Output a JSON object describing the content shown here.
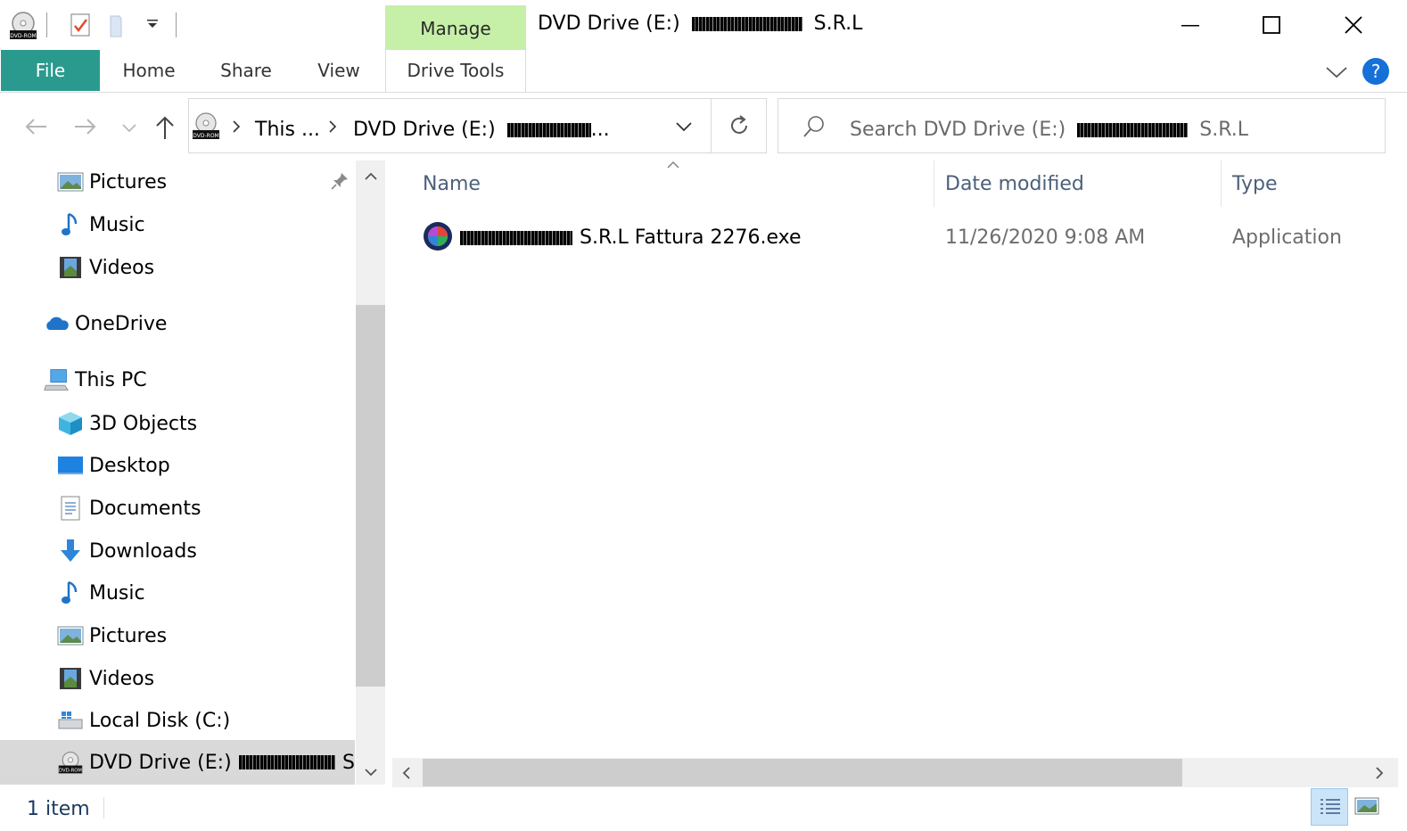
{
  "title_bar": {
    "manage_tab": "Manage",
    "title_prefix": "DVD Drive (E:)",
    "title_suffix": "S.R.L"
  },
  "ribbon": {
    "tabs": [
      "File",
      "Home",
      "Share",
      "View",
      "Drive Tools"
    ]
  },
  "address_bar": {
    "crumbs": [
      "This ...",
      "DVD Drive (E:)"
    ],
    "crumb_ellipsis": "..."
  },
  "search": {
    "placeholder_prefix": "Search DVD Drive (E:)",
    "placeholder_suffix": "S.R.L"
  },
  "nav_pane": {
    "quick_items": [
      {
        "label": "Pictures",
        "icon": "pictures-icon"
      },
      {
        "label": "Music",
        "icon": "music-icon"
      },
      {
        "label": "Videos",
        "icon": "videos-icon"
      }
    ],
    "onedrive": "OneDrive",
    "this_pc": "This PC",
    "pc_items": [
      {
        "label": "3D Objects",
        "icon": "3d-objects-icon"
      },
      {
        "label": "Desktop",
        "icon": "desktop-icon"
      },
      {
        "label": "Documents",
        "icon": "documents-icon"
      },
      {
        "label": "Downloads",
        "icon": "downloads-icon"
      },
      {
        "label": "Music",
        "icon": "music-icon"
      },
      {
        "label": "Pictures",
        "icon": "pictures-icon"
      },
      {
        "label": "Videos",
        "icon": "videos-icon"
      },
      {
        "label": "Local Disk (C:)",
        "icon": "local-disk-icon"
      }
    ],
    "selected_item": "DVD Drive (E:)",
    "selected_item_tail": "S"
  },
  "file_list": {
    "columns": [
      "Name",
      "Date modified",
      "Type"
    ],
    "rows": [
      {
        "name_suffix": "S.R.L Fattura 2276.exe",
        "date": "11/26/2020 9:08 AM",
        "type": "Application"
      }
    ]
  },
  "status_bar": {
    "item_count": "1 item"
  },
  "colors": {
    "file_tab": "#2b9a8e",
    "manage_tab": "#c6efa8",
    "selection": "#cce4f7",
    "header_text": "#4c607a"
  }
}
